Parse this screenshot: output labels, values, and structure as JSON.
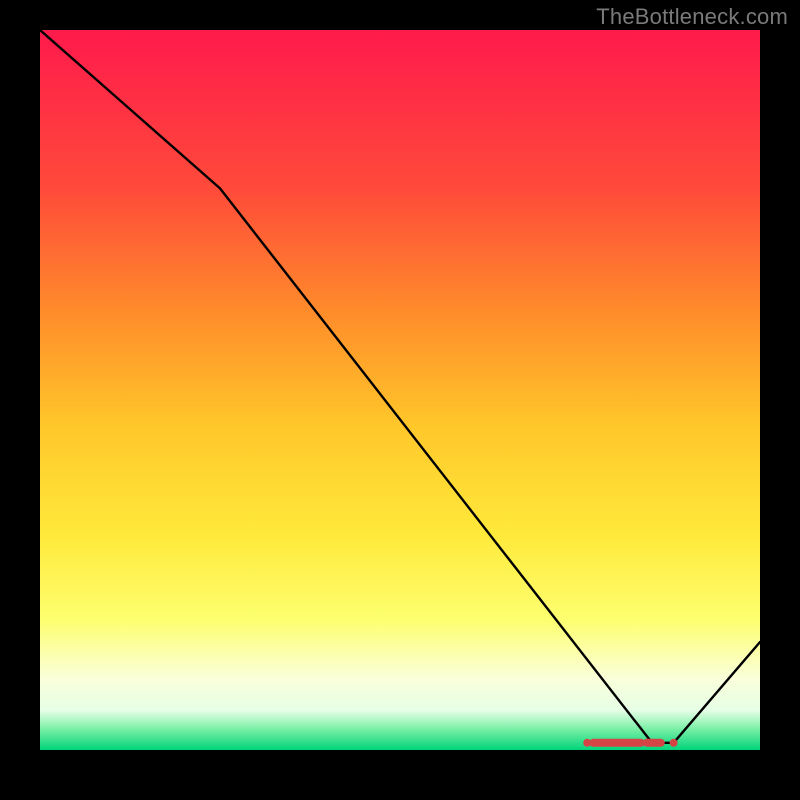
{
  "watermark": "TheBottleneck.com",
  "chart_data": {
    "type": "line",
    "title": "",
    "xlabel": "",
    "ylabel": "",
    "x": [
      0,
      25,
      85,
      88,
      100
    ],
    "values": [
      100,
      78,
      1,
      1,
      15
    ],
    "xlim": [
      0,
      100
    ],
    "ylim": [
      0,
      100
    ],
    "valley_marker": {
      "x_start": 76,
      "x_end": 88,
      "y": 1
    },
    "background_gradient": {
      "stops": [
        {
          "offset": 0.0,
          "color": "#ff1a4c"
        },
        {
          "offset": 0.22,
          "color": "#ff4a3a"
        },
        {
          "offset": 0.4,
          "color": "#ff8f2a"
        },
        {
          "offset": 0.55,
          "color": "#ffc72a"
        },
        {
          "offset": 0.7,
          "color": "#ffe93a"
        },
        {
          "offset": 0.82,
          "color": "#fdff70"
        },
        {
          "offset": 0.9,
          "color": "#faffda"
        },
        {
          "offset": 0.945,
          "color": "#e6ffe6"
        },
        {
          "offset": 0.97,
          "color": "#7ef0a8"
        },
        {
          "offset": 1.0,
          "color": "#00d47a"
        }
      ]
    }
  }
}
